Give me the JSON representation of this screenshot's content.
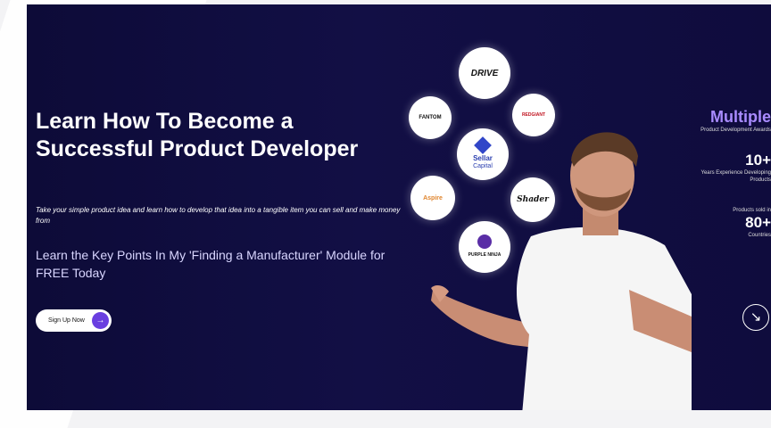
{
  "hero": {
    "title": "Learn How To Become a Successful Product Developer",
    "subtitle": "Take your simple product idea and learn how to develop that idea into a tangible item you can sell and make money from",
    "lead": "Learn the Key Points In My 'Finding a Manufacturer' Module for FREE Today",
    "cta_label": "Sign Up Now",
    "cta_icon": "arrow-right-icon"
  },
  "logos": {
    "drive": "DRIVE",
    "fantom": "FANTOM",
    "redgiant": "REDGIANT",
    "sellar_1": "Sellar",
    "sellar_2": "Capital",
    "shader": "Shader",
    "purple_ninja": "PURPLE NINJA",
    "aspire": "Aspire"
  },
  "stats": {
    "multiple": "Multiple",
    "awards": "Product Development Awards",
    "years_value": "10+",
    "years_label": "Years Experience Developing Products",
    "sold_label": "Products sold in",
    "countries_value": "80+",
    "countries_label": "Countries"
  },
  "colors": {
    "hero_bg": "#0d0b38",
    "accent": "#6a3fe0",
    "highlight": "#a98bff"
  }
}
